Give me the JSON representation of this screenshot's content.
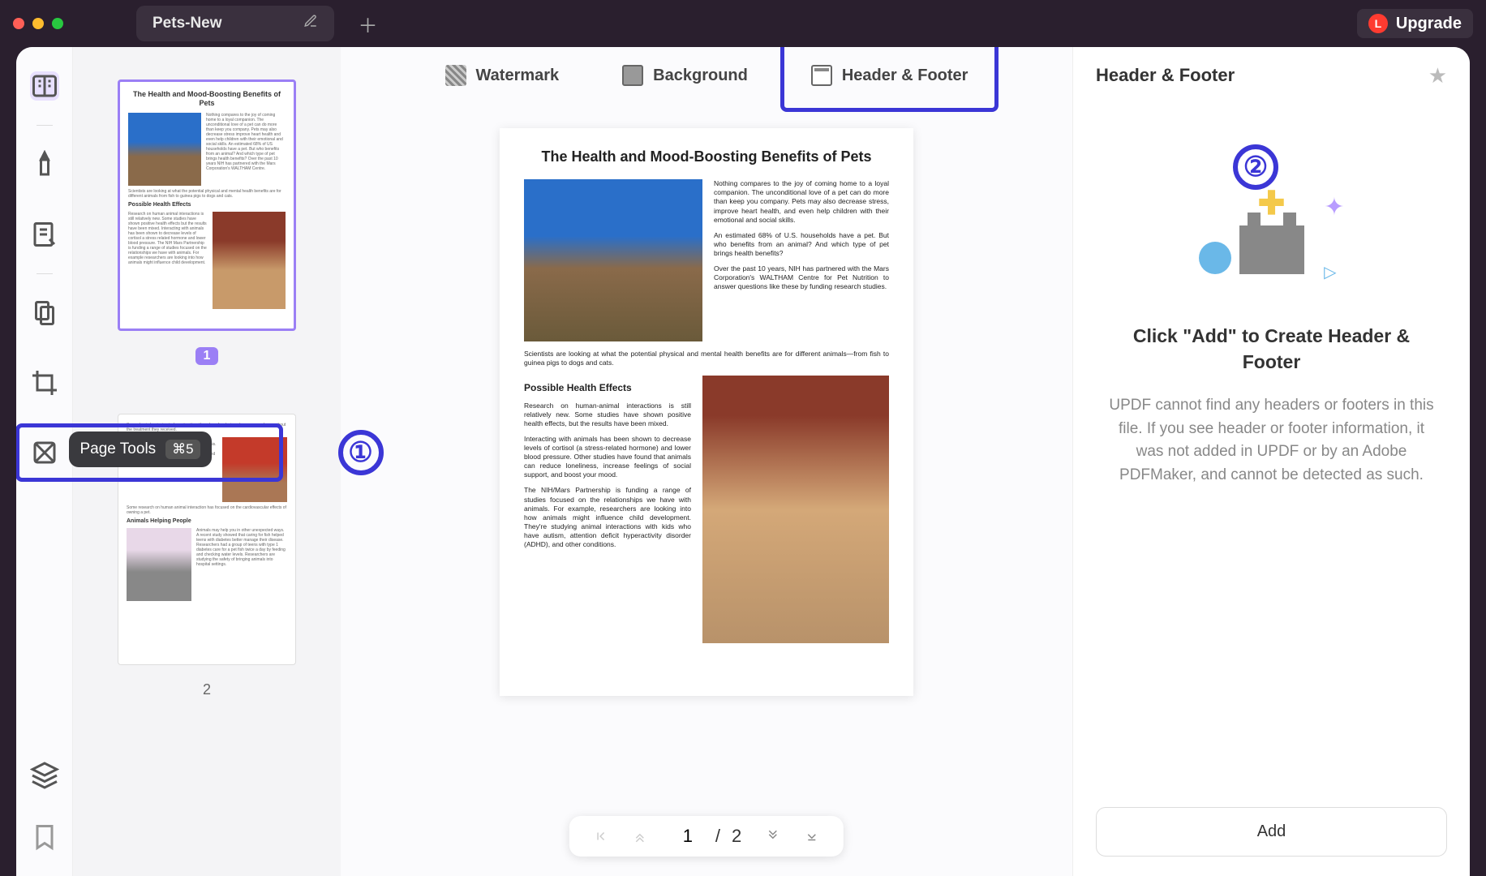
{
  "titlebar": {
    "tab_title": "Pets-New",
    "upgrade_label": "Upgrade",
    "upgrade_badge": "L"
  },
  "tooltip": {
    "label": "Page Tools",
    "shortcut": "⌘5"
  },
  "callouts": {
    "one": "①",
    "two": "②"
  },
  "thumbnails": {
    "page1_num": "1",
    "page2_num": "2",
    "page1_title": "The Health and Mood-Boosting Benefits of Pets"
  },
  "toolbar": {
    "watermark": "Watermark",
    "background": "Background",
    "header_footer": "Header & Footer"
  },
  "document": {
    "title": "The Health and Mood-Boosting Benefits of Pets",
    "p1": "Nothing compares to the joy of coming home to a loyal companion. The unconditional love of a pet can do more than keep you company. Pets may also decrease stress, improve heart health, and even help children with their emotional and social skills.",
    "p2": "An estimated 68% of U.S. households have a pet. But who benefits from an animal? And which type of pet brings health benefits?",
    "p3": "Over the past 10 years, NIH has partnered with the Mars Corporation's WALTHAM Centre for Pet Nutrition to answer questions like these by funding research studies.",
    "span": "Scientists are looking at what the potential physical and mental health benefits are for different animals—from fish to guinea pigs to dogs and cats.",
    "subtitle": "Possible Health Effects",
    "p4": "Research on human-animal interactions is still relatively new. Some studies have shown positive health effects, but the results have been mixed.",
    "p5": "Interacting with animals has been shown to decrease levels of cortisol (a stress-related hormone) and lower blood pressure. Other studies have found that animals can reduce loneliness, increase feelings of social support, and boost your mood.",
    "p6": "The NIH/Mars Partnership is funding a range of studies focused on the relationships we have with animals. For example, researchers are looking into how animals might influence child development. They're studying animal interactions with kids who have autism, attention deficit hyperactivity disorder (ADHD), and other conditions."
  },
  "pager": {
    "current": "1",
    "sep": "/",
    "total": "2"
  },
  "panel": {
    "title": "Header & Footer",
    "heading": "Click \"Add\" to Create Header & Footer",
    "description": "UPDF cannot find any headers or footers in this file. If you see header or footer information, it was not added in UPDF or by an Adobe PDFMaker, and cannot be detected as such.",
    "add_button": "Add"
  }
}
